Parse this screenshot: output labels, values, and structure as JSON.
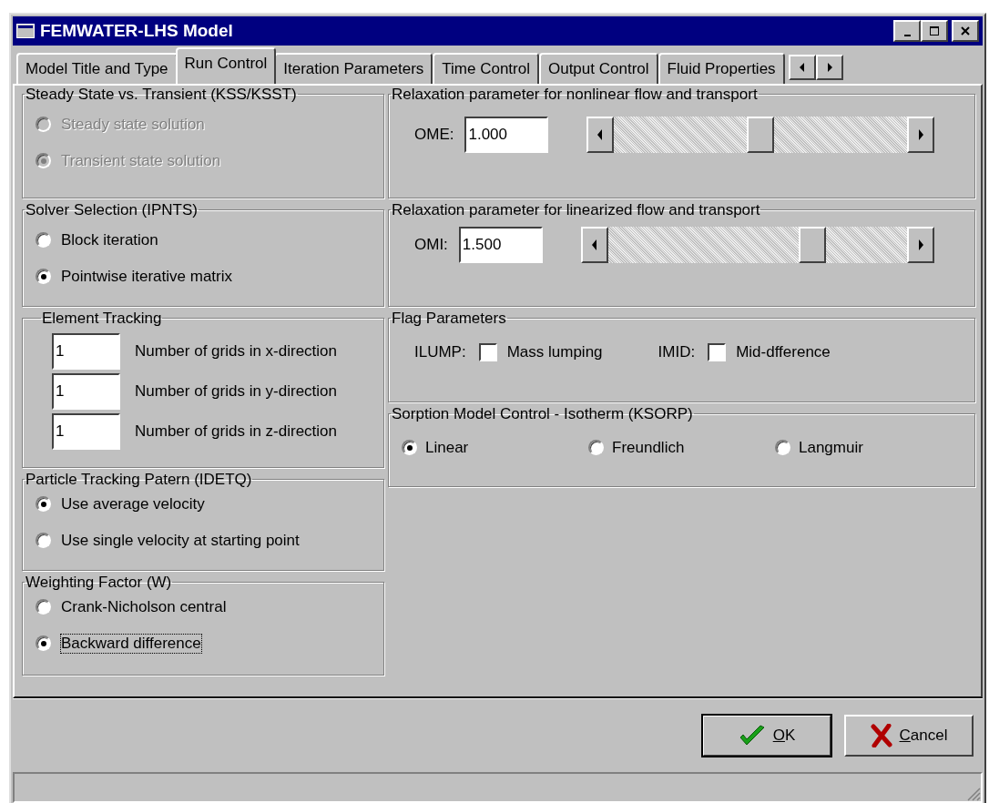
{
  "window": {
    "title": "FEMWATER-LHS Model"
  },
  "tabs": [
    {
      "label": "Model Title and Type",
      "selected": false
    },
    {
      "label": "Run Control",
      "selected": true
    },
    {
      "label": "Iteration Parameters",
      "selected": false
    },
    {
      "label": "Time Control",
      "selected": false
    },
    {
      "label": "Output Control",
      "selected": false
    },
    {
      "label": "Fluid Properties",
      "selected": false
    }
  ],
  "left_groups": [
    {
      "kind": "radio",
      "title": "Steady State vs. Transient (KSS/KSST)",
      "options": [
        {
          "label": "Steady state solution",
          "selected": false,
          "disabled": true,
          "focused": false
        },
        {
          "label": "Transient state solution",
          "selected": true,
          "disabled": true,
          "focused": false
        }
      ]
    },
    {
      "kind": "radio",
      "title": "Solver Selection (IPNTS)",
      "options": [
        {
          "label": "Block iteration",
          "selected": false,
          "disabled": false,
          "focused": false
        },
        {
          "label": "Pointwise iterative matrix",
          "selected": true,
          "disabled": false,
          "focused": false
        }
      ]
    },
    {
      "kind": "fields",
      "title": "Element Tracking",
      "rows": [
        {
          "value": "1",
          "label": "Number of grids in x-direction"
        },
        {
          "value": "1",
          "label": "Number of grids in y-direction"
        },
        {
          "value": "1",
          "label": "Number of grids in z-direction"
        }
      ]
    },
    {
      "kind": "radio",
      "title": "Particle Tracking Patern (IDETQ)",
      "options": [
        {
          "label": "Use average velocity",
          "selected": true,
          "disabled": false,
          "focused": false
        },
        {
          "label": "Use single velocity at starting point",
          "selected": false,
          "disabled": false,
          "focused": false
        }
      ]
    },
    {
      "kind": "radio",
      "title": "Weighting Factor (W)",
      "options": [
        {
          "label": "Crank-Nicholson central",
          "selected": false,
          "disabled": false,
          "focused": false
        },
        {
          "label": "Backward difference",
          "selected": true,
          "disabled": false,
          "focused": true
        }
      ]
    }
  ],
  "right_groups": [
    {
      "kind": "slider",
      "title": "Relaxation parameter for nonlinear flow and transport",
      "field_label": "OME:",
      "value": "1.000",
      "level": 0.5
    },
    {
      "kind": "slider",
      "title": "Relaxation parameter for linearized flow and transport",
      "field_label": "OMI:",
      "value": "1.500",
      "level": 0.7
    },
    {
      "kind": "checks",
      "title": "Flag Parameters",
      "items": [
        {
          "prefix": "ILUMP:",
          "label": "Mass lumping",
          "checked": false
        },
        {
          "prefix": "IMID:",
          "label": "Mid-dfference",
          "checked": false
        }
      ]
    },
    {
      "kind": "radio_row",
      "title": "Sorption Model Control - Isotherm (KSORP)",
      "options": [
        {
          "label": "Linear",
          "selected": true
        },
        {
          "label": "Freundlich",
          "selected": false
        },
        {
          "label": "Langmuir",
          "selected": false
        }
      ]
    }
  ],
  "buttons": [
    {
      "kind": "ok",
      "label": "OK"
    },
    {
      "kind": "cancel",
      "label": "Cancel"
    }
  ]
}
